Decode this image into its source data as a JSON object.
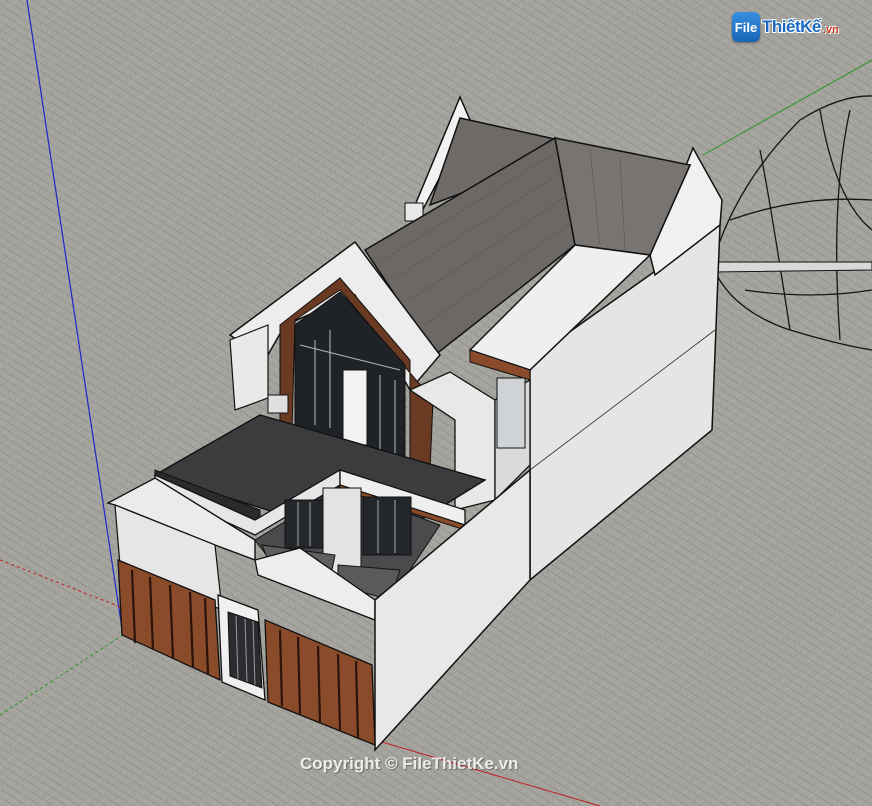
{
  "watermark": {
    "logo_mark": "File",
    "logo_text": "ThiếtKế",
    "logo_suffix": ".vn",
    "copyright": "Copyright © FileThietKe.vn"
  },
  "scene": {
    "background_color": "#a6a49e",
    "wall_color": "#ebebeb",
    "roof_color": "#6b6866",
    "wood_color": "#8a4b2a",
    "glass_color": "#1f2328",
    "axis_blue": "#1d27c8",
    "axis_green": "#1f9a1f",
    "axis_red": "#c02020"
  }
}
